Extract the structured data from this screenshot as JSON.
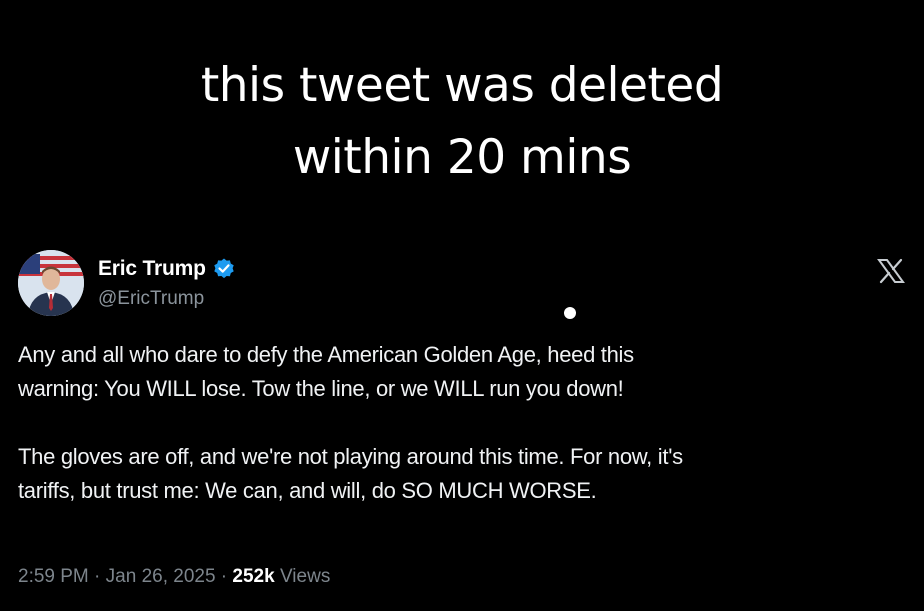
{
  "caption": {
    "line1": "this tweet was deleted",
    "line2": "within 20 mins"
  },
  "tweet": {
    "display_name": "Eric Trump",
    "handle": "@EricTrump",
    "verified_icon": "verified-badge-icon",
    "platform_icon": "x-logo-icon",
    "avatar_icon": "profile-photo",
    "body": {
      "paragraph1": {
        "line1": "Any and all who dare to defy the American Golden Age, heed this",
        "line2": "warning: You WILL lose. Tow the line, or we WILL run you down!"
      },
      "paragraph2": {
        "line1": "The gloves are off, and we're not playing around this time. For now, it's",
        "line2": "tariffs, but trust me: We can, and will, do SO MUCH WORSE."
      }
    },
    "meta": {
      "time": "2:59 PM",
      "separator1": " · ",
      "date": "Jan 26, 2025",
      "separator2": " · ",
      "views_count": "252k",
      "views_label": " Views"
    }
  },
  "colors": {
    "background": "#000000",
    "verified_blue": "#1d9bf0",
    "secondary_text": "#7d858c",
    "primary_text": "#f0f2f4"
  }
}
